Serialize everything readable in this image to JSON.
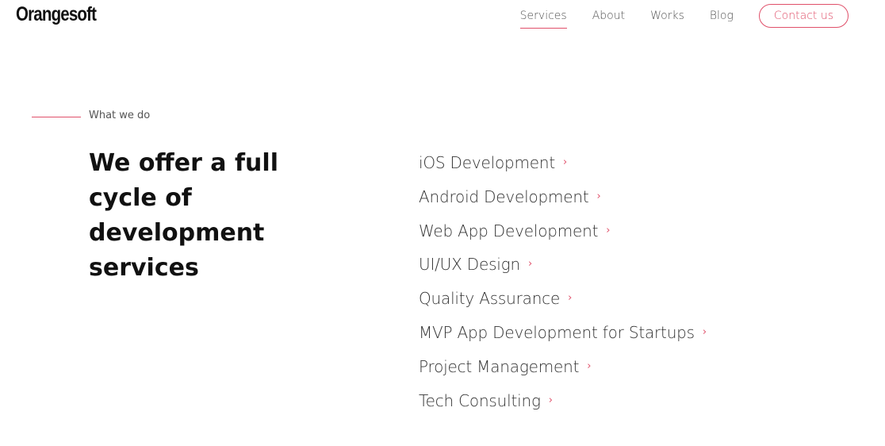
{
  "header": {
    "logo_text": "Orangesoft",
    "nav": [
      {
        "label": "Services",
        "active": true
      },
      {
        "label": "About",
        "active": false
      },
      {
        "label": "Works",
        "active": false
      },
      {
        "label": "Blog",
        "active": false
      }
    ],
    "contact_label": "Contact us"
  },
  "section": {
    "eyebrow": "What we do",
    "headline": "We offer a full cycle of development services",
    "services": [
      {
        "label": "iOS Development"
      },
      {
        "label": "Android Development"
      },
      {
        "label": "Web App Development"
      },
      {
        "label": "UI/UX Design"
      },
      {
        "label": "Quality Assurance"
      },
      {
        "label": "MVP App Development for Startups"
      },
      {
        "label": "Project Management"
      },
      {
        "label": "Tech Consulting"
      }
    ],
    "chevron_glyph": "›"
  },
  "colors": {
    "accent": "#e0506a",
    "text_dark": "#111111",
    "text_muted": "#555555"
  }
}
